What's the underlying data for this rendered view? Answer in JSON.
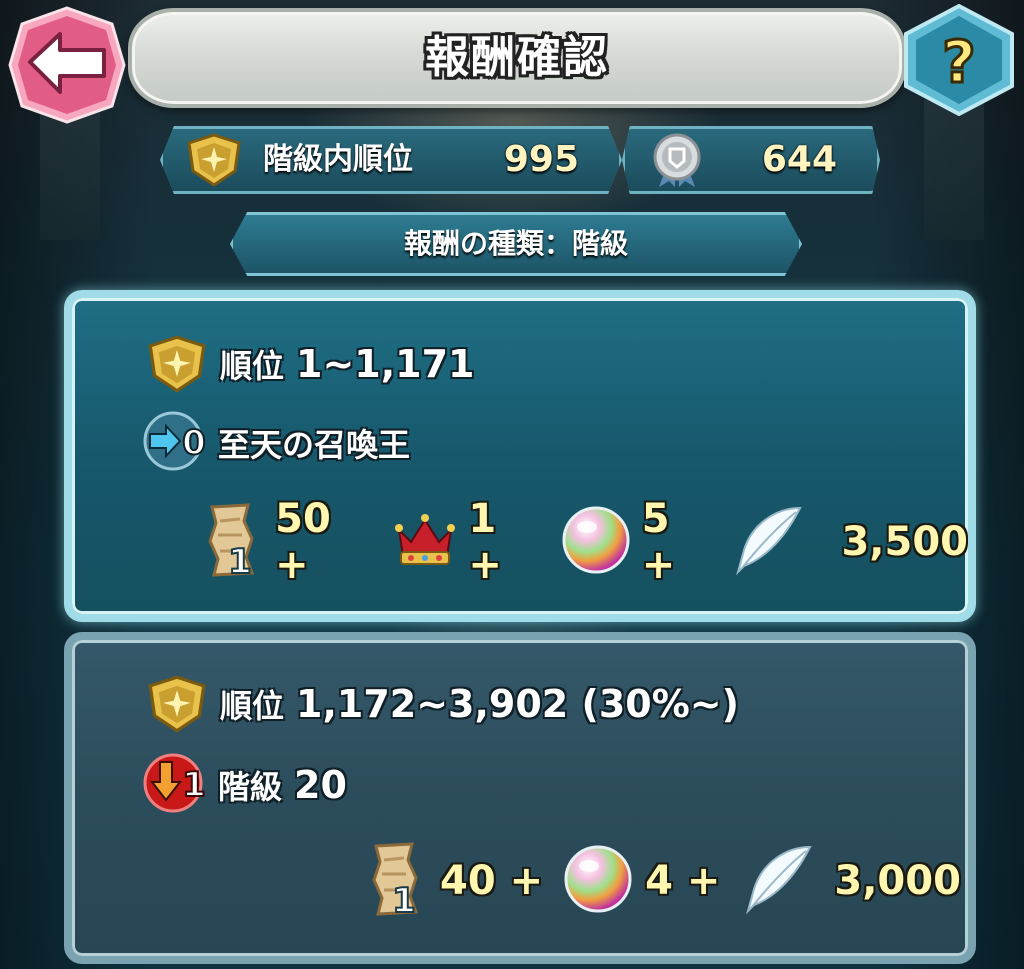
{
  "header": {
    "title": "報酬確認"
  },
  "stats": {
    "rank_label": "階級内順位",
    "rank_value": "995",
    "medal_value": "644"
  },
  "reward_type": "報酬の種類：階級",
  "tiers": [
    {
      "rank_label": "順位",
      "rank_range": "1~1,171",
      "change_value": "0",
      "status_text": "至天の召喚王",
      "scroll_badge": "1",
      "rewards": {
        "scroll": "50 +",
        "crown": "1 +",
        "orb": "5 +",
        "feather": "3,500"
      }
    },
    {
      "rank_label": "順位",
      "rank_range": "1,172~3,902 (30%~)",
      "change_value": "1",
      "status_label": "階級",
      "status_value": "20",
      "scroll_badge": "1",
      "rewards": {
        "scroll": "40 +",
        "orb": "4 +",
        "feather": "3,000"
      }
    }
  ],
  "colors": {
    "accent": "#fff6b0",
    "panel_active": "#1f6f85",
    "panel_inactive": "#2b4c5b",
    "back_button": "#e25d86",
    "help_button": "#2b8aa6"
  },
  "icons": {
    "back": "arrow-left-icon",
    "help": "question-mark-icon",
    "rank": "gold-shield-icon",
    "medal": "silver-medal-icon",
    "promote": "arrow-right-icon",
    "demote": "arrow-down-icon",
    "scroll": "scroll-icon",
    "crown": "crown-icon",
    "orb": "orb-icon",
    "feather": "feather-icon"
  }
}
